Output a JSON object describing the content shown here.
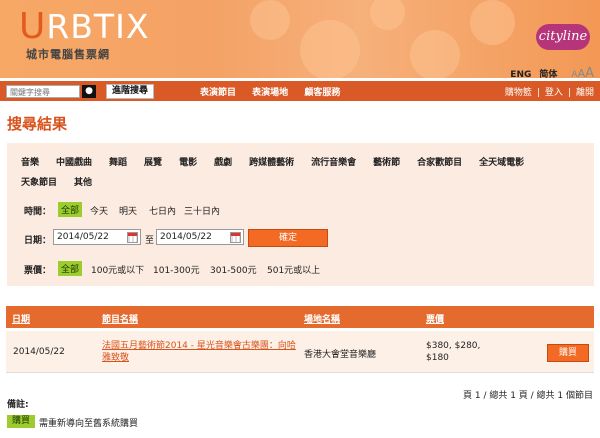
{
  "header": {
    "logo_first": "U",
    "logo_rest": "RBTIX",
    "logo_sub": "城市電腦售票網",
    "cityline": "cityline",
    "lang_eng": "ENG",
    "lang_simp": "简体",
    "font_sizes": [
      "A",
      "A",
      "A"
    ]
  },
  "nav": {
    "search_placeholder": "關鍵字搜尋",
    "search_icon": "🔍",
    "advanced_search": "進階搜尋",
    "links": [
      "表演節目",
      "表演場地",
      "顧客服務"
    ],
    "cart": "購物籃",
    "login": "登入",
    "logout": "離開"
  },
  "page": {
    "title": "搜尋結果"
  },
  "filter": {
    "categories": [
      "音樂",
      "中國戲曲",
      "舞蹈",
      "展覽",
      "電影",
      "戲劇",
      "跨媒體藝術",
      "流行音樂會",
      "藝術節",
      "合家歡節目",
      "全天域電影",
      "天象節目",
      "其他"
    ],
    "time_label": "時間：",
    "time_options": [
      "全部",
      "今天",
      "明天",
      "七日內",
      "三十日內"
    ],
    "date_label": "日期：",
    "date_from": "2014/05/22",
    "date_to_sep": "至",
    "date_to": "2014/05/22",
    "confirm": "確定",
    "price_label": "票價：",
    "price_options": [
      "全部",
      "100元或以下",
      "101-300元",
      "301-500元",
      "501元或以上"
    ]
  },
  "table": {
    "headers": [
      "日期",
      "節目名稱",
      "場地名稱",
      "票價"
    ],
    "rows": [
      {
        "date": "2014/05/22",
        "title_line1": "法國五月藝術節2014 - 星光音樂會古樂團：向哈",
        "title_line2": "雅致敬",
        "venue": "香港大會堂音樂廳",
        "price_line1": "$380, $280,",
        "price_line2": "$180",
        "buy": "購買"
      }
    ]
  },
  "pager": "頁 1 / 總共 1 頁 / 總共 1 個節目",
  "notes": {
    "title": "備註:",
    "badge": "購買",
    "text": "需重新導向至舊系統購買"
  },
  "colors": {
    "accent": "#d95a27",
    "selected": "#9ccc2e",
    "button": "#f26a24"
  }
}
